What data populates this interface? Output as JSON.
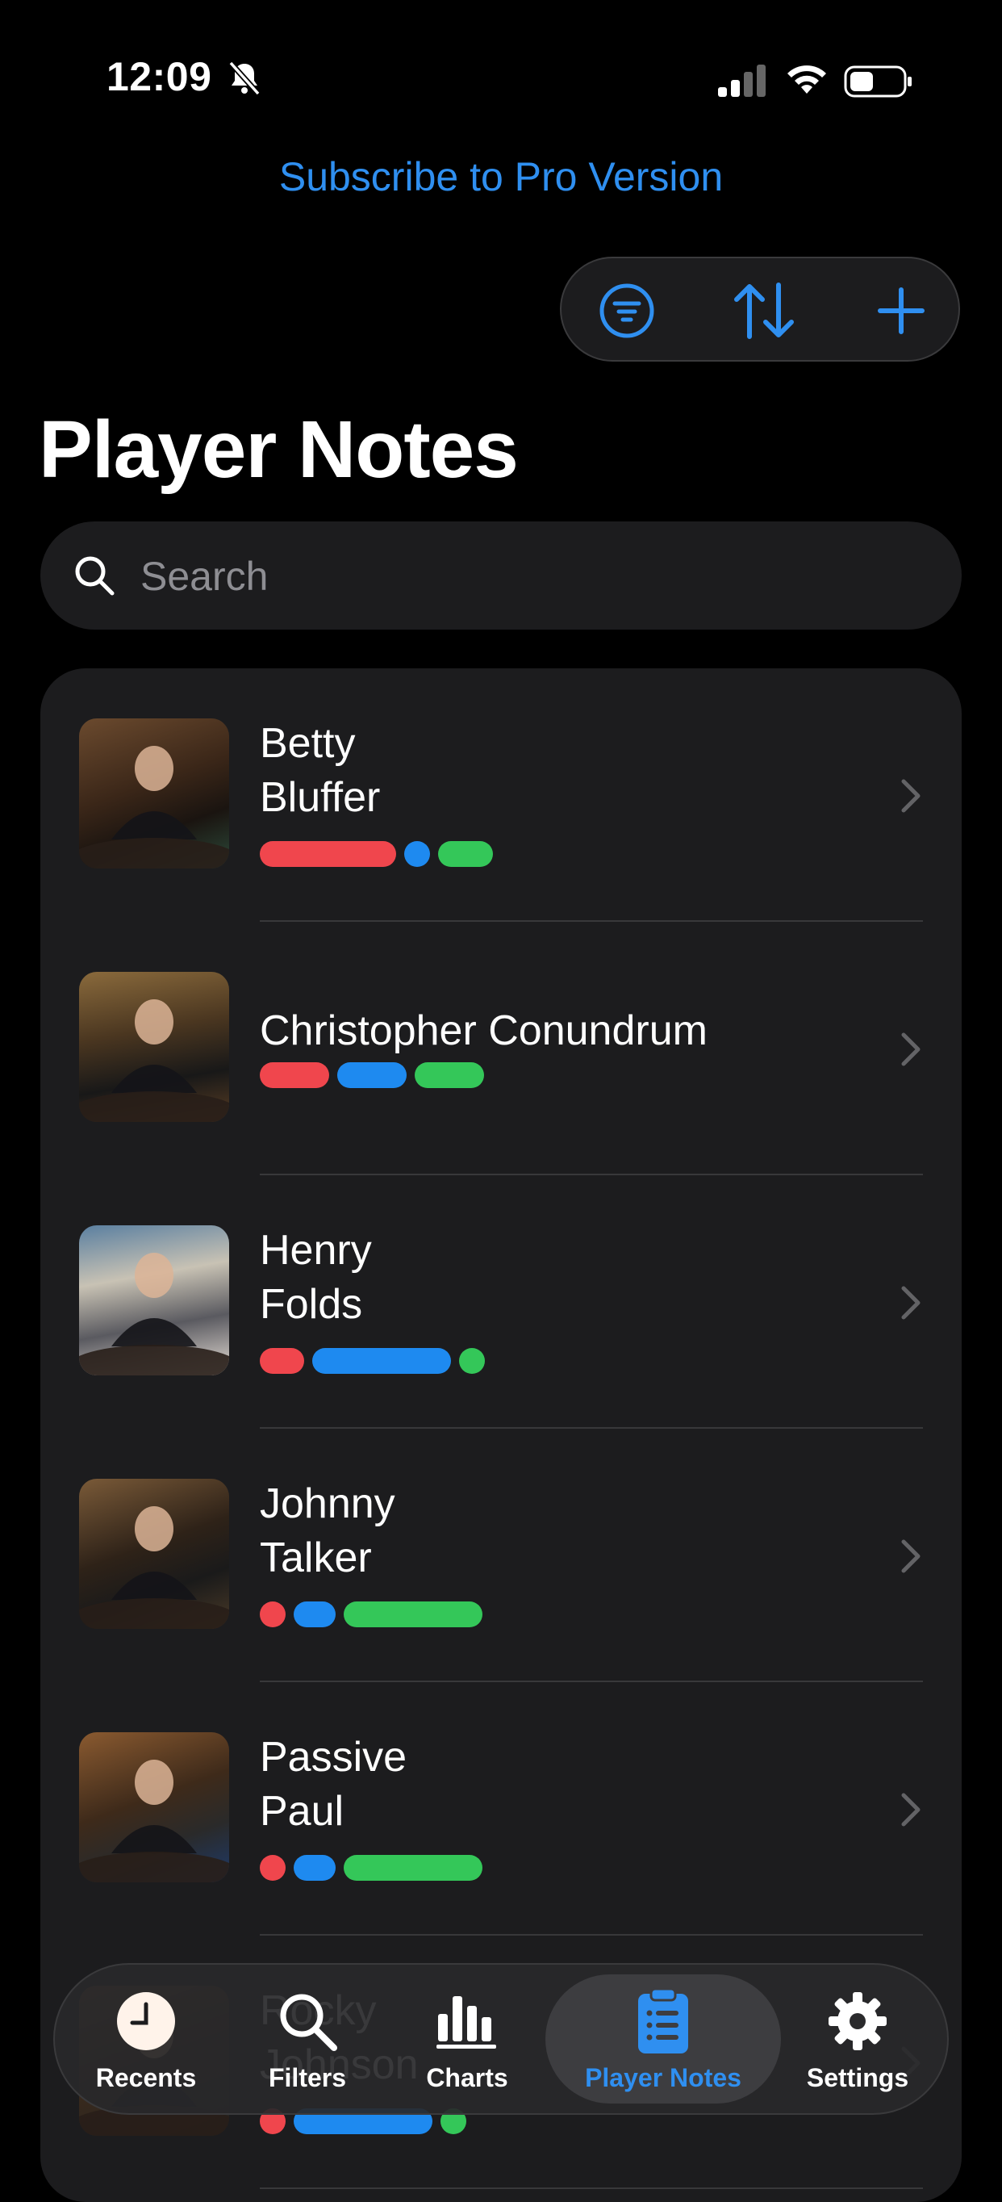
{
  "status_bar": {
    "time": "12:09"
  },
  "header": {
    "subscribe_label": "Subscribe to Pro Version",
    "title": "Player Notes",
    "actions": [
      {
        "icon": "filter-icon"
      },
      {
        "icon": "sort-icon"
      },
      {
        "icon": "plus-icon"
      }
    ]
  },
  "search": {
    "placeholder": "Search",
    "value": ""
  },
  "players": [
    {
      "name": "Betty\nBluffer",
      "bars": [
        0.55,
        0.05,
        0.22
      ]
    },
    {
      "name": "Christopher Conundrum",
      "bars": [
        0.28,
        0.28,
        0.28
      ]
    },
    {
      "name": "Henry\nFolds",
      "bars": [
        0.18,
        0.56,
        0.05
      ]
    },
    {
      "name": "Johnny\nTalker",
      "bars": [
        0.05,
        0.17,
        0.56
      ]
    },
    {
      "name": "Passive\nPaul",
      "bars": [
        0.05,
        0.17,
        0.56
      ]
    },
    {
      "name": "Rocky\nJohnson",
      "bars": [
        0.05,
        0.56,
        0.05
      ]
    }
  ],
  "colors": {
    "accent": "#2f8ff0",
    "bar_red": "#f0464d",
    "bar_blue": "#1e8af0",
    "bar_green": "#34c759"
  },
  "tabbar": {
    "tabs": [
      {
        "label": "Recents",
        "icon": "clock-icon",
        "active": false
      },
      {
        "label": "Filters",
        "icon": "search-icon",
        "active": false
      },
      {
        "label": "Charts",
        "icon": "bar-chart-icon",
        "active": false
      },
      {
        "label": "Player Notes",
        "icon": "clipboard-icon",
        "active": true
      },
      {
        "label": "Settings",
        "icon": "gear-icon",
        "active": false
      }
    ]
  }
}
